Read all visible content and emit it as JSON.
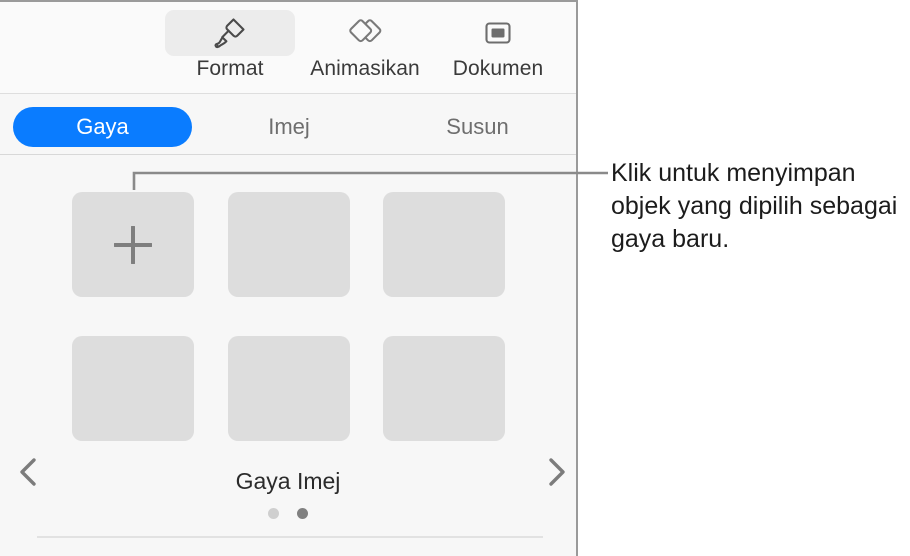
{
  "toolbar": {
    "buttons": [
      {
        "label": "Format",
        "icon": "paintbrush-icon",
        "selected": true
      },
      {
        "label": "Animasikan",
        "icon": "animate-diamonds-icon",
        "selected": false
      },
      {
        "label": "Dokumen",
        "icon": "document-rect-icon",
        "selected": false
      }
    ]
  },
  "tabs": {
    "items": [
      {
        "label": "Gaya",
        "active": true
      },
      {
        "label": "Imej",
        "active": false
      },
      {
        "label": "Susun",
        "active": false
      }
    ],
    "active_color": "#0a7cff"
  },
  "style_grid": {
    "add_button_icon": "plus-icon",
    "prev_arrow_icon": "chevron-left-icon",
    "next_arrow_icon": "chevron-right-icon",
    "cells": [
      {
        "type": "add",
        "row": 1,
        "col": 1
      },
      {
        "type": "empty",
        "row": 1,
        "col": 2
      },
      {
        "type": "empty",
        "row": 1,
        "col": 3
      },
      {
        "type": "empty",
        "row": 2,
        "col": 1
      },
      {
        "type": "empty",
        "row": 2,
        "col": 2
      },
      {
        "type": "empty",
        "row": 2,
        "col": 3
      }
    ],
    "caption": "Gaya Imej",
    "pagination": {
      "total": 2,
      "current": 2,
      "dot_inactive_color": "#cfcfcf",
      "dot_active_color": "#808080"
    }
  },
  "callout": {
    "text": "Klik untuk menyimpan objek yang dipilih sebagai gaya baru.",
    "line_color": "#8a8a8a"
  }
}
